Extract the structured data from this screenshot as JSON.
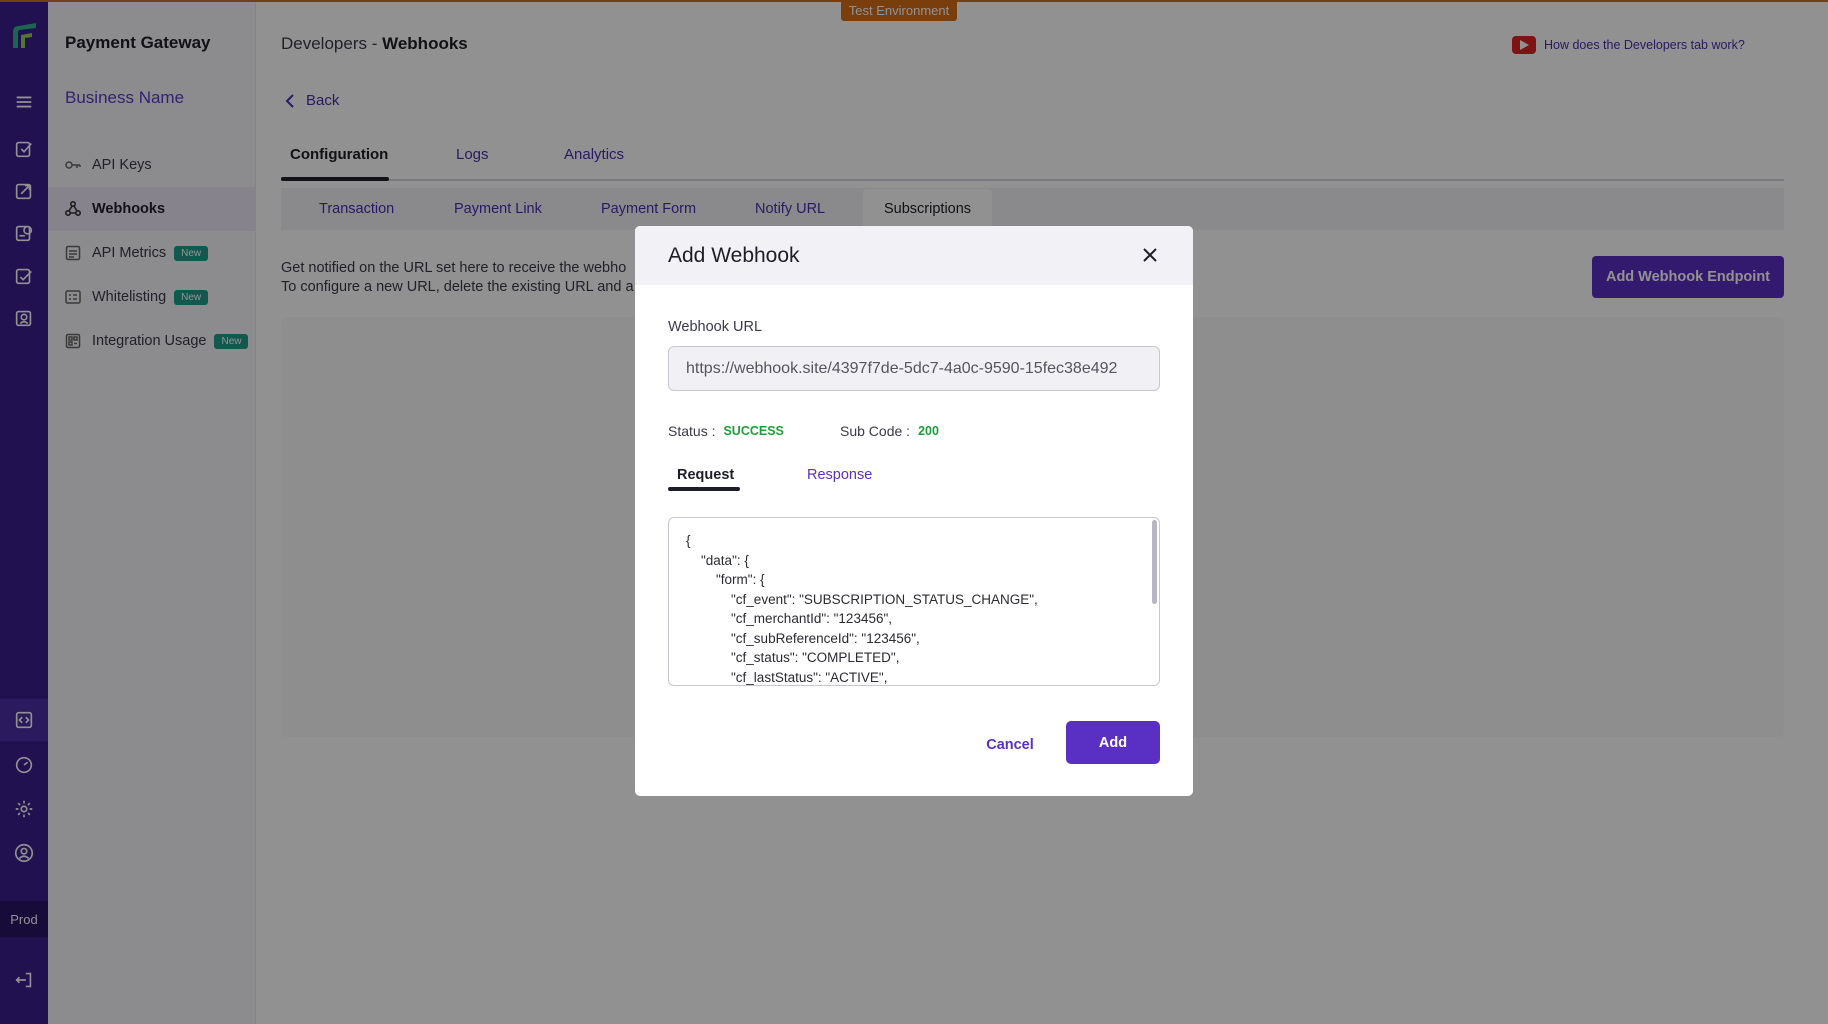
{
  "environment_label": "Test Environment",
  "rail": {
    "env_label": "Prod"
  },
  "sidebar": {
    "brand": "Payment Gateway",
    "business_name": "Business Name",
    "items": [
      {
        "label": "API Keys",
        "badge": ""
      },
      {
        "label": "Webhooks",
        "badge": ""
      },
      {
        "label": "API Metrics",
        "badge": "New"
      },
      {
        "label": "Whitelisting",
        "badge": "New"
      },
      {
        "label": "Integration Usage",
        "badge": "New"
      }
    ]
  },
  "header": {
    "breadcrumb_parent": "Developers -",
    "breadcrumb_current": "Webhooks",
    "help_link": "How does the Developers tab work?"
  },
  "back_label": "Back",
  "tabs": [
    "Configuration",
    "Logs",
    "Analytics"
  ],
  "subtabs": [
    "Transaction",
    "Payment Link",
    "Payment Form",
    "Notify URL",
    "Subscriptions"
  ],
  "description": {
    "line1": "Get notified on the URL set here to receive the webho",
    "line2": "To configure a new URL, delete the existing URL and a"
  },
  "add_endpoint_label": "Add Webhook Endpoint",
  "modal": {
    "title": "Add Webhook",
    "url_label": "Webhook URL",
    "url_value": "https://webhook.site/4397f7de-5dc7-4a0c-9590-15fec38e492",
    "status_label": "Status :",
    "status_value": "SUCCESS",
    "subcode_label": "Sub Code :",
    "subcode_value": "200",
    "tab_request": "Request",
    "tab_response": "Response",
    "request_body": "{\n    \"data\": {\n        \"form\": {\n            \"cf_event\": \"SUBSCRIPTION_STATUS_CHANGE\",\n            \"cf_merchantId\": \"123456\",\n            \"cf_subReferenceId\": \"123456\",\n            \"cf_status\": \"COMPLETED\",\n            \"cf_lastStatus\": \"ACTIVE\",",
    "cancel_label": "Cancel",
    "add_label": "Add"
  },
  "colors": {
    "brand": "#3b1e8e",
    "accent": "#5a2fc4",
    "success": "#1e9e3b",
    "env": "#d66b16"
  }
}
